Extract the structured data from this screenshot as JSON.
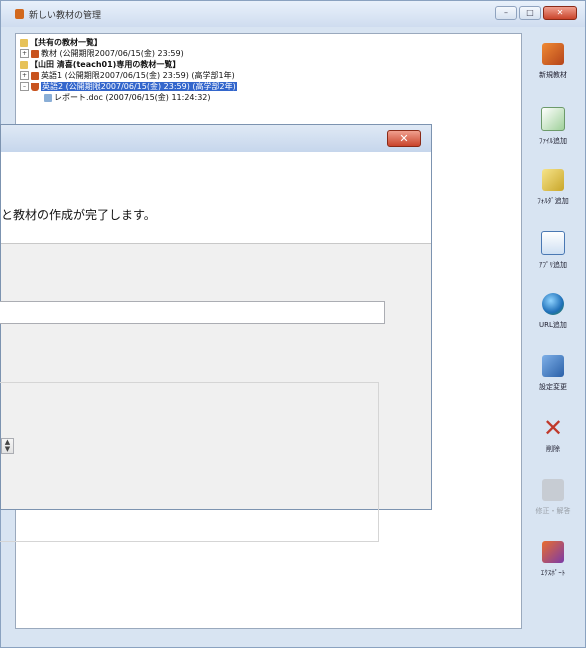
{
  "main_window": {
    "title": "新しい教材の管理",
    "tree": [
      {
        "id": "shared-header",
        "text": "【共有の教材一覧】",
        "bold": true
      },
      {
        "id": "shared-item",
        "text": "教材 (公開期限2007/06/15(金) 23:59)"
      },
      {
        "id": "private-header",
        "text": "【山田 清喜(teach01)専用の教材一覧】",
        "bold": true
      },
      {
        "id": "english1",
        "text": "英語1 (公開期限2007/06/15(金) 23:59) (高学部1年)"
      },
      {
        "id": "english2",
        "text": "英語2 (公開期限2007/06/15(金) 23:59) (高学部2年)",
        "selected": true
      },
      {
        "id": "report-doc",
        "text": "レポート.doc (2007/06/15(金) 11:24:32)"
      }
    ],
    "toolbar": [
      {
        "id": "new-material",
        "label": "新規教材",
        "icon": "new-material-icon"
      },
      {
        "id": "add-file",
        "label": "ﾌｧｲﾙ追加",
        "icon": "add-file-icon"
      },
      {
        "id": "add-folder",
        "label": "ﾌｫﾙﾀﾞ追加",
        "icon": "add-folder-icon"
      },
      {
        "id": "add-app",
        "label": "ｱﾌﾟﾘ追加",
        "icon": "add-app-icon"
      },
      {
        "id": "add-url",
        "label": "URL追加",
        "icon": "globe-icon"
      },
      {
        "id": "settings",
        "label": "設定変更",
        "icon": "settings-icon"
      },
      {
        "id": "delete",
        "label": "削除",
        "icon": "delete-icon"
      },
      {
        "id": "edit",
        "label": "修正・解答",
        "icon": "shirt-icon",
        "disabled": true
      },
      {
        "id": "export",
        "label": "ｴｸｽﾎﾟｰﾄ",
        "icon": "export-icon"
      }
    ]
  },
  "dialog": {
    "message": "と教材の作成が完了します。",
    "close_label": "✕"
  }
}
